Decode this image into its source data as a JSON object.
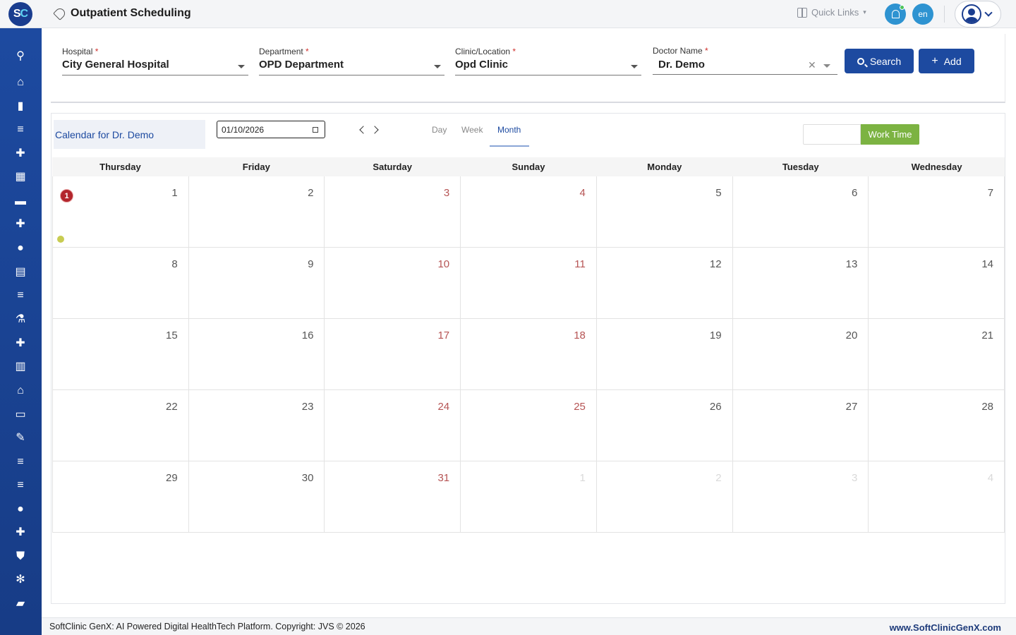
{
  "header": {
    "logo_text": "SC",
    "title": "Outpatient Scheduling",
    "quick_links_label": "Quick Links",
    "language": "en"
  },
  "sidebar": {
    "items": [
      {
        "icon": "search-icon",
        "glyph": "⚲"
      },
      {
        "icon": "home-icon",
        "glyph": "⌂"
      },
      {
        "icon": "bar-chart-icon",
        "glyph": "▮"
      },
      {
        "icon": "menu-icon",
        "glyph": "≡"
      },
      {
        "icon": "medical-bag-icon",
        "glyph": "✚"
      },
      {
        "icon": "calendar-icon",
        "glyph": "▦"
      },
      {
        "icon": "bed-icon",
        "glyph": "▬"
      },
      {
        "icon": "hospital-plus-icon",
        "glyph": "✚"
      },
      {
        "icon": "person-icon",
        "glyph": "●"
      },
      {
        "icon": "receipt-icon",
        "glyph": "▤"
      },
      {
        "icon": "list-icon",
        "glyph": "≡"
      },
      {
        "icon": "pharmacy-icon",
        "glyph": "⚗"
      },
      {
        "icon": "medicine-bottle-icon",
        "glyph": "✚"
      },
      {
        "icon": "book-icon",
        "glyph": "▥"
      },
      {
        "icon": "warehouse-icon",
        "glyph": "⌂"
      },
      {
        "icon": "devices-icon",
        "glyph": "▭"
      },
      {
        "icon": "wrench-icon",
        "glyph": "✎"
      },
      {
        "icon": "list-icon-2",
        "glyph": "≡"
      },
      {
        "icon": "list-icon-3",
        "glyph": "≡"
      },
      {
        "icon": "drop-icon",
        "glyph": "●"
      },
      {
        "icon": "add-box-icon",
        "glyph": "✚"
      },
      {
        "icon": "shield-icon",
        "glyph": "⛊"
      },
      {
        "icon": "hub-icon",
        "glyph": "✻"
      },
      {
        "icon": "folder-icon",
        "glyph": "▰"
      }
    ]
  },
  "filters": {
    "hospital": {
      "label": "Hospital",
      "value": "City General Hospital"
    },
    "department": {
      "label": "Department",
      "value": "OPD Department"
    },
    "clinic": {
      "label": "Clinic/Location",
      "value": "Opd Clinic"
    },
    "doctor": {
      "label": "Doctor Name",
      "value": "Dr. Demo"
    },
    "required_mark": "*",
    "search_label": "Search",
    "add_label": "Add"
  },
  "calendar": {
    "title": "Calendar for Dr. Demo",
    "date_value": "01/10/2026",
    "views": [
      "Day",
      "Week",
      "Month"
    ],
    "active_view": "Month",
    "work_time_label": "Work Time",
    "weekdays": [
      "Thursday",
      "Friday",
      "Saturday",
      "Sunday",
      "Monday",
      "Tuesday",
      "Wednesday"
    ],
    "weeks": [
      [
        {
          "d": "1",
          "t": "n"
        },
        {
          "d": "2",
          "t": "n"
        },
        {
          "d": "3",
          "t": "w"
        },
        {
          "d": "4",
          "t": "w"
        },
        {
          "d": "5",
          "t": "n"
        },
        {
          "d": "6",
          "t": "n"
        },
        {
          "d": "7",
          "t": "n"
        }
      ],
      [
        {
          "d": "8",
          "t": "n"
        },
        {
          "d": "9",
          "t": "n"
        },
        {
          "d": "10",
          "t": "w"
        },
        {
          "d": "11",
          "t": "w"
        },
        {
          "d": "12",
          "t": "n"
        },
        {
          "d": "13",
          "t": "n"
        },
        {
          "d": "14",
          "t": "n"
        }
      ],
      [
        {
          "d": "15",
          "t": "n"
        },
        {
          "d": "16",
          "t": "n"
        },
        {
          "d": "17",
          "t": "w"
        },
        {
          "d": "18",
          "t": "w"
        },
        {
          "d": "19",
          "t": "n"
        },
        {
          "d": "20",
          "t": "n"
        },
        {
          "d": "21",
          "t": "n"
        }
      ],
      [
        {
          "d": "22",
          "t": "n"
        },
        {
          "d": "23",
          "t": "n"
        },
        {
          "d": "24",
          "t": "w"
        },
        {
          "d": "25",
          "t": "w"
        },
        {
          "d": "26",
          "t": "n"
        },
        {
          "d": "27",
          "t": "n"
        },
        {
          "d": "28",
          "t": "n"
        }
      ],
      [
        {
          "d": "29",
          "t": "n"
        },
        {
          "d": "30",
          "t": "n"
        },
        {
          "d": "31",
          "t": "w"
        },
        {
          "d": "1",
          "t": "o"
        },
        {
          "d": "2",
          "t": "o"
        },
        {
          "d": "3",
          "t": "o"
        },
        {
          "d": "4",
          "t": "o"
        }
      ]
    ],
    "event_badge_count": "1"
  },
  "footer": {
    "copyright": "SoftClinic GenX: AI Powered Digital HealthTech Platform. Copyright: JVS © 2026",
    "website": "www.SoftClinicGenX.com"
  },
  "colors": {
    "primary": "#1d4aa0",
    "weekend_text": "#b65454",
    "work_time": "#7cb342",
    "event_badge": "#b3262d"
  }
}
